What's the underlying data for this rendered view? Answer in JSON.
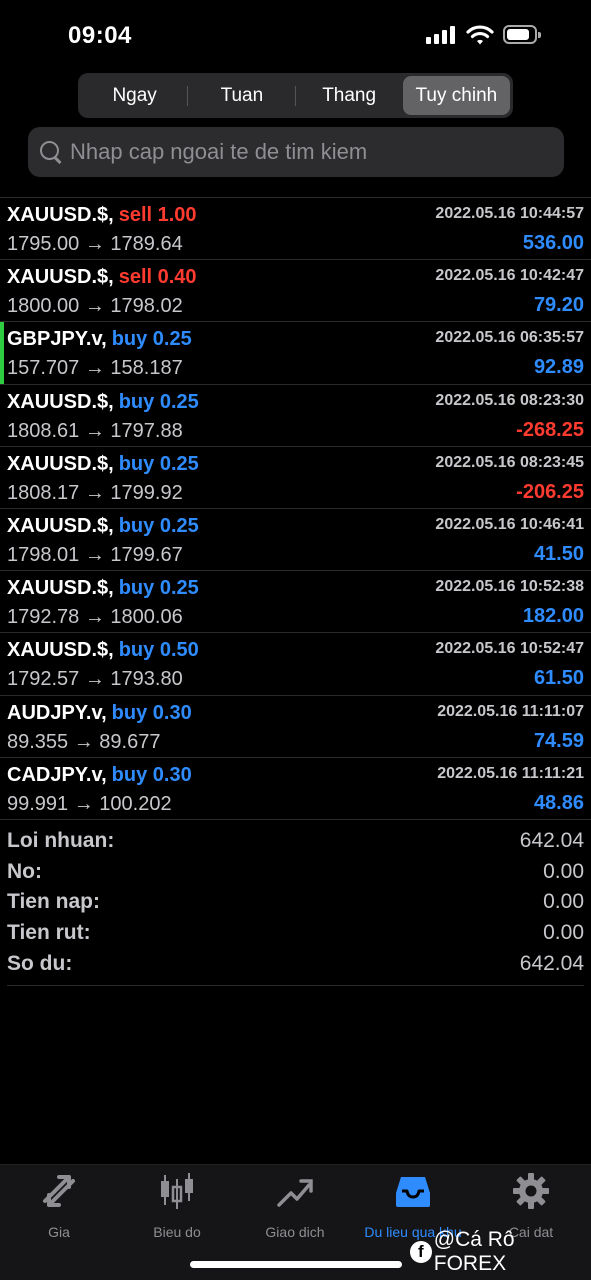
{
  "status": {
    "time": "09:04"
  },
  "period_tabs": [
    {
      "label": "Ngay",
      "active": false
    },
    {
      "label": "Tuan",
      "active": false
    },
    {
      "label": "Thang",
      "active": false
    },
    {
      "label": "Tuy chinh",
      "active": true
    }
  ],
  "search": {
    "placeholder": "Nhap cap ngoai te de tim kiem",
    "value": ""
  },
  "trades": [
    {
      "symbol": "XAUUSD.$,",
      "side": "sell",
      "lot": "1.00",
      "side_label": "sell 1.00",
      "time": "2022.05.16 10:44:57",
      "open": "1795.00",
      "close": "1789.64",
      "arrow": "→",
      "profit": "536.00",
      "profit_sign": "pos"
    },
    {
      "symbol": "XAUUSD.$,",
      "side": "sell",
      "lot": "0.40",
      "side_label": "sell 0.40",
      "time": "2022.05.16 10:42:47",
      "open": "1800.00",
      "close": "1798.02",
      "arrow": "→",
      "profit": "79.20",
      "profit_sign": "pos"
    },
    {
      "symbol": "GBPJPY.v,",
      "side": "buy",
      "lot": "0.25",
      "side_label": "buy 0.25",
      "time": "2022.05.16 06:35:57",
      "open": "157.707",
      "close": "158.187",
      "arrow": "→",
      "profit": "92.89",
      "profit_sign": "pos",
      "selected": true
    },
    {
      "symbol": "XAUUSD.$,",
      "side": "buy",
      "lot": "0.25",
      "side_label": "buy 0.25",
      "time": "2022.05.16 08:23:30",
      "open": "1808.61",
      "close": "1797.88",
      "arrow": "→",
      "profit": "-268.25",
      "profit_sign": "neg"
    },
    {
      "symbol": "XAUUSD.$,",
      "side": "buy",
      "lot": "0.25",
      "side_label": "buy 0.25",
      "time": "2022.05.16 08:23:45",
      "open": "1808.17",
      "close": "1799.92",
      "arrow": "→",
      "profit": "-206.25",
      "profit_sign": "neg"
    },
    {
      "symbol": "XAUUSD.$,",
      "side": "buy",
      "lot": "0.25",
      "side_label": "buy 0.25",
      "time": "2022.05.16 10:46:41",
      "open": "1798.01",
      "close": "1799.67",
      "arrow": "→",
      "profit": "41.50",
      "profit_sign": "pos"
    },
    {
      "symbol": "XAUUSD.$,",
      "side": "buy",
      "lot": "0.25",
      "side_label": "buy 0.25",
      "time": "2022.05.16 10:52:38",
      "open": "1792.78",
      "close": "1800.06",
      "arrow": "→",
      "profit": "182.00",
      "profit_sign": "pos"
    },
    {
      "symbol": "XAUUSD.$,",
      "side": "buy",
      "lot": "0.50",
      "side_label": "buy 0.50",
      "time": "2022.05.16 10:52:47",
      "open": "1792.57",
      "close": "1793.80",
      "arrow": "→",
      "profit": "61.50",
      "profit_sign": "pos"
    },
    {
      "symbol": "AUDJPY.v,",
      "side": "buy",
      "lot": "0.30",
      "side_label": "buy 0.30",
      "time": "2022.05.16 11:11:07",
      "open": "89.355",
      "close": "89.677",
      "arrow": "→",
      "profit": "74.59",
      "profit_sign": "pos"
    },
    {
      "symbol": "CADJPY.v,",
      "side": "buy",
      "lot": "0.30",
      "side_label": "buy 0.30",
      "time": "2022.05.16 11:11:21",
      "open": "99.991",
      "close": "100.202",
      "arrow": "→",
      "profit": "48.86",
      "profit_sign": "pos"
    }
  ],
  "summary": [
    {
      "label": "Loi nhuan:",
      "value": "642.04"
    },
    {
      "label": "No:",
      "value": "0.00"
    },
    {
      "label": "Tien nap:",
      "value": "0.00"
    },
    {
      "label": "Tien rut:",
      "value": "0.00"
    },
    {
      "label": "So du:",
      "value": "642.04"
    }
  ],
  "tabbar": [
    {
      "label": "Gia",
      "icon": "quotes-arrows-icon",
      "active": false
    },
    {
      "label": "Bieu do",
      "icon": "candlestick-chart-icon",
      "active": false
    },
    {
      "label": "Giao dich",
      "icon": "trade-trend-icon",
      "active": false
    },
    {
      "label": "Du lieu qua khu",
      "icon": "history-inbox-icon",
      "active": true
    },
    {
      "label": "Cai dat",
      "icon": "gear-icon",
      "active": false
    }
  ],
  "watermark": {
    "icon_letter": "f",
    "text": "@Cá Rô FOREX"
  },
  "colors": {
    "buy": "#2f8cff",
    "sell": "#ff3b30",
    "accent": "#2f8cff",
    "selected_marker": "#2ecc40"
  }
}
